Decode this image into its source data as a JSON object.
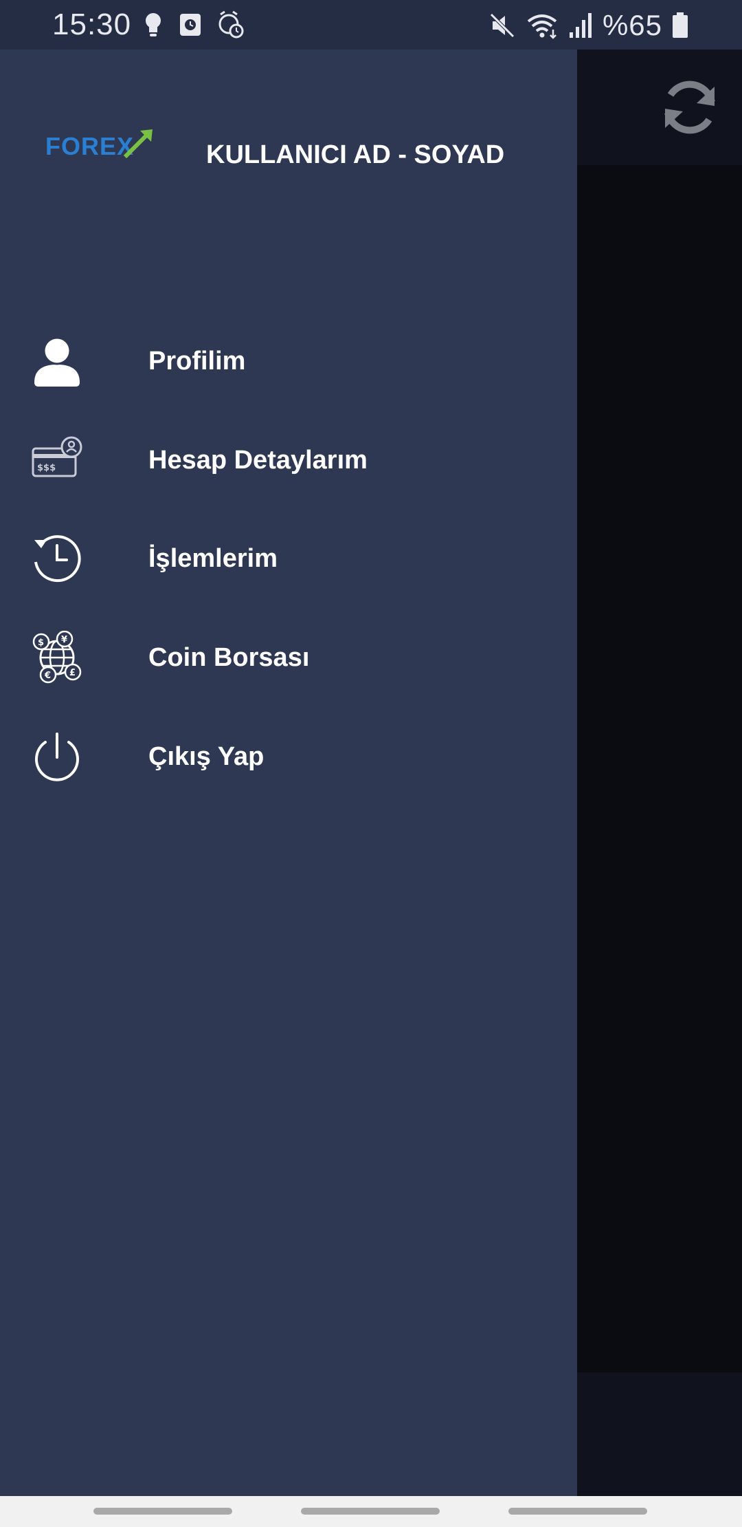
{
  "status_bar": {
    "time": "15:30",
    "battery": "%65",
    "left_icons": [
      "bulb-icon",
      "square-clock-icon",
      "alarm-icon"
    ],
    "right_icons": [
      "mute-icon",
      "wifi-icon",
      "signal-icon",
      "battery-icon"
    ]
  },
  "drawer": {
    "logo_text": "FOREX",
    "user_name": "KULLANICI AD - SOYAD",
    "items": [
      {
        "label": "Profilim",
        "icon": "user-icon"
      },
      {
        "label": "Hesap Detaylarım",
        "icon": "account-card-icon"
      },
      {
        "label": "İşlemlerim",
        "icon": "history-icon"
      },
      {
        "label": "Coin Borsası",
        "icon": "currency-exchange-icon"
      },
      {
        "label": "Çıkış Yap",
        "icon": "power-icon"
      }
    ]
  },
  "main": {
    "header_icon": "refresh-icon"
  },
  "colors": {
    "drawer_bg": "#2e3853",
    "status_bg": "#252d44",
    "logo_blue": "#2a7fd2",
    "logo_green": "#7ac143"
  }
}
